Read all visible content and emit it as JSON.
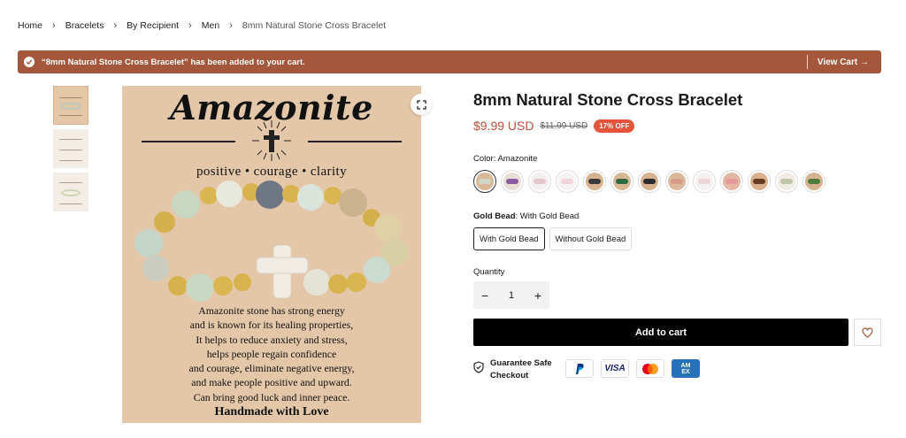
{
  "breadcrumb": {
    "items": [
      "Home",
      "Bracelets",
      "By Recipient",
      "Men",
      "8mm Natural Stone Cross Bracelet"
    ]
  },
  "notice": {
    "message": "“8mm Natural Stone Cross Bracelet” has been added to your cart.",
    "view_cart": "View Cart →",
    "color": "#a4573a"
  },
  "gallery": {
    "image_title": "Amazonite",
    "tagline": "positive • courage • clarity",
    "description_lines": [
      "Amazonite stone has strong energy",
      "and is known for its healing properties,",
      "It helps to reduce anxiety and stress,",
      "helps people regain confidence",
      "and courage, eliminate negative energy,",
      "and make people positive and upward.",
      "Can bring good luck and inner peace."
    ],
    "signature": "Handmade with Love",
    "expand_icon": "expand-icon",
    "thumbnail_count": 3
  },
  "product": {
    "title": "8mm Natural Stone Cross Bracelet",
    "price": "$9.99 USD",
    "compare_price": "$11.99 USD",
    "discount_badge": "17% OFF",
    "price_color": "#c0503a",
    "badge_color": "#e4533a"
  },
  "color_option": {
    "label": "Color",
    "value": "Amazonite",
    "swatches": [
      {
        "bg": "#d9b896",
        "bead": "#cfd6c4"
      },
      {
        "bg": "#e8ded6",
        "bead": "#8a5ca0"
      },
      {
        "bg": "#f3efee",
        "bead": "#e6c7d0"
      },
      {
        "bg": "#f7f2f2",
        "bead": "#efd5da"
      },
      {
        "bg": "#d7b391",
        "bead": "#3a3a3a"
      },
      {
        "bg": "#d8b794",
        "bead": "#2f6a3f"
      },
      {
        "bg": "#d6b190",
        "bead": "#2b2b2b"
      },
      {
        "bg": "#ddb89b",
        "bead": "#d79b8c"
      },
      {
        "bg": "#f6f1f1",
        "bead": "#ecd6d9"
      },
      {
        "bg": "#e3b7a3",
        "bead": "#e49a9a"
      },
      {
        "bg": "#d9b08e",
        "bead": "#6b3a22"
      },
      {
        "bg": "#f0ece4",
        "bead": "#bfc6a6"
      },
      {
        "bg": "#d6b390",
        "bead": "#4f7a38"
      }
    ]
  },
  "gold_option": {
    "label": "Gold Bead",
    "value": "With Gold Bead",
    "choices": [
      "With Gold Bead",
      "Without Gold Bead"
    ]
  },
  "quantity": {
    "label": "Quantity",
    "value": "1",
    "minus": "−",
    "plus": "+"
  },
  "actions": {
    "add_to_cart": "Add to cart",
    "wishlist_icon": "heart-icon"
  },
  "guarantee": {
    "text": "Guarantee Safe Checkout",
    "payments": [
      "PayPal",
      "VISA",
      "Mastercard",
      "American Express"
    ]
  }
}
